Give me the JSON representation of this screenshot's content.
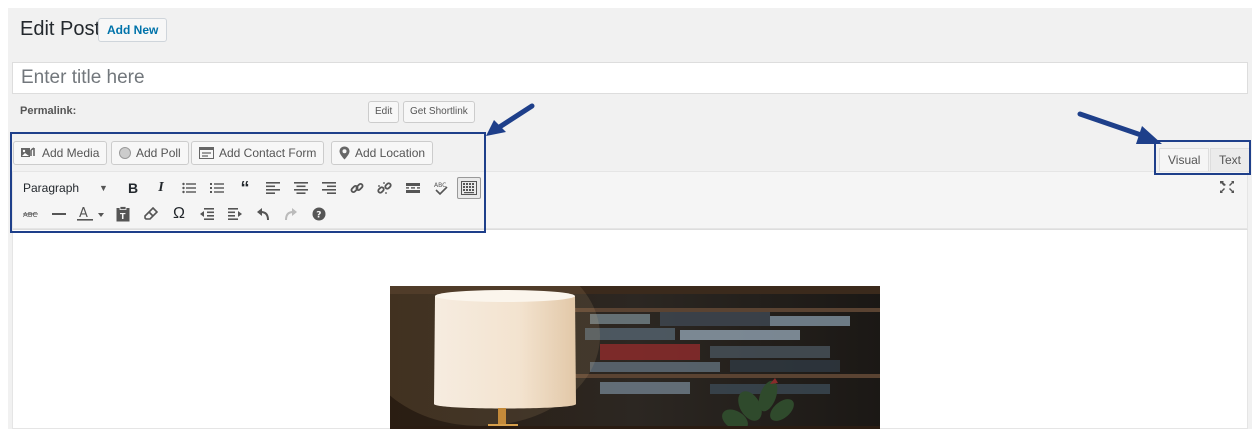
{
  "header": {
    "title": "Edit Post",
    "add_new_label": "Add New"
  },
  "title_field": {
    "placeholder": "Enter title here"
  },
  "permalink": {
    "label": "Permalink:",
    "edit_label": "Edit",
    "shortlink_label": "Get Shortlink"
  },
  "media_buttons": {
    "add_media": "Add Media",
    "add_poll": "Add Poll",
    "add_contact_form": "Add Contact Form",
    "add_location": "Add Location"
  },
  "editor_tabs": {
    "visual": "Visual",
    "text": "Text",
    "active": "visual"
  },
  "toolbar": {
    "format_value": "Paragraph",
    "row1_icons": [
      "bold-icon",
      "italic-icon",
      "bulleted-list-icon",
      "numbered-list-icon",
      "blockquote-icon",
      "align-left-icon",
      "align-center-icon",
      "align-right-icon",
      "insert-link-icon",
      "remove-link-icon",
      "read-more-icon",
      "spellcheck-icon",
      "toolbar-toggle-icon"
    ],
    "row2_icons": [
      "strikethrough-icon",
      "horizontal-line-icon",
      "text-color-icon",
      "paste-as-text-icon",
      "clear-formatting-icon",
      "special-character-icon",
      "outdent-icon",
      "indent-icon",
      "undo-icon",
      "redo-icon",
      "keyboard-shortcuts-icon"
    ]
  },
  "colors": {
    "annotation_blue": "#1e3f8a",
    "link_blue": "#0073aa",
    "admin_bg": "#f1f1f1"
  }
}
